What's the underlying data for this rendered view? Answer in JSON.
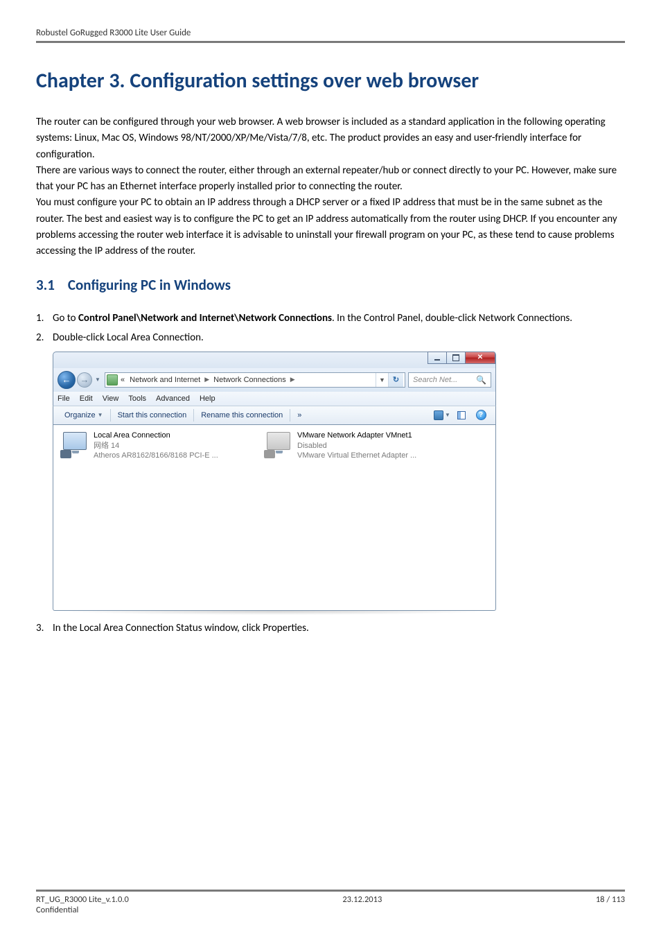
{
  "header": {
    "doc_title": "Robustel GoRugged R3000 Lite User Guide"
  },
  "chapter": {
    "title": "Chapter 3.  Configuration settings over web browser"
  },
  "intro_text": "The router can be configured through your web browser. A web browser is included as a standard application in the following operating systems: Linux, Mac OS, Windows 98/NT/2000/XP/Me/Vista/7/8, etc. The product provides an easy and user-friendly interface for configuration.\nThere are various ways to connect the router, either through an external repeater/hub or connect directly to your PC. However, make sure that your PC has an Ethernet interface properly installed prior to connecting the router.\nYou must configure your PC to obtain an IP address through a DHCP server or a fixed IP address that must be in the same subnet as the router. The best and easiest way is to configure the PC to get an IP address automatically from the router using DHCP. If you encounter any problems accessing the router web interface it is advisable to uninstall your firewall program on your PC, as these tend to cause problems accessing the IP address of the router.",
  "section": {
    "number": "3.1",
    "title": "Configuring PC in Windows"
  },
  "list": {
    "item1_prefix": "Go to ",
    "item1_bold": "Control Panel\\Network and Internet\\Network Connections",
    "item1_suffix": ". In the Control Panel, double-click Network Connections.",
    "item2": "Double-click Local Area Connection.",
    "item3": "In the Local Area Connection Status window, click Properties."
  },
  "screenshot": {
    "breadcrumb": {
      "lead": "«",
      "part1": "Network and Internet",
      "part2": "Network Connections"
    },
    "search_placeholder": "Search Net...",
    "menu": {
      "file": "File",
      "edit": "Edit",
      "view": "View",
      "tools": "Tools",
      "advanced": "Advanced",
      "help": "Help"
    },
    "toolbar": {
      "organize": "Organize",
      "start_conn": "Start this connection",
      "rename_conn": "Rename this connection",
      "overflow": "»"
    },
    "cards": {
      "lan": {
        "title": "Local Area Connection",
        "sub1": "网络 14",
        "sub2": "Atheros AR8162/8166/8168 PCI-E ..."
      },
      "vmnet": {
        "title": "VMware Network Adapter VMnet1",
        "sub1": "Disabled",
        "sub2": "VMware Virtual Ethernet Adapter ..."
      }
    }
  },
  "footer": {
    "left": "RT_UG_R3000 Lite_v.1.0.0",
    "left2": "Confidential",
    "center": "23.12.2013",
    "right": "18 / 113"
  }
}
